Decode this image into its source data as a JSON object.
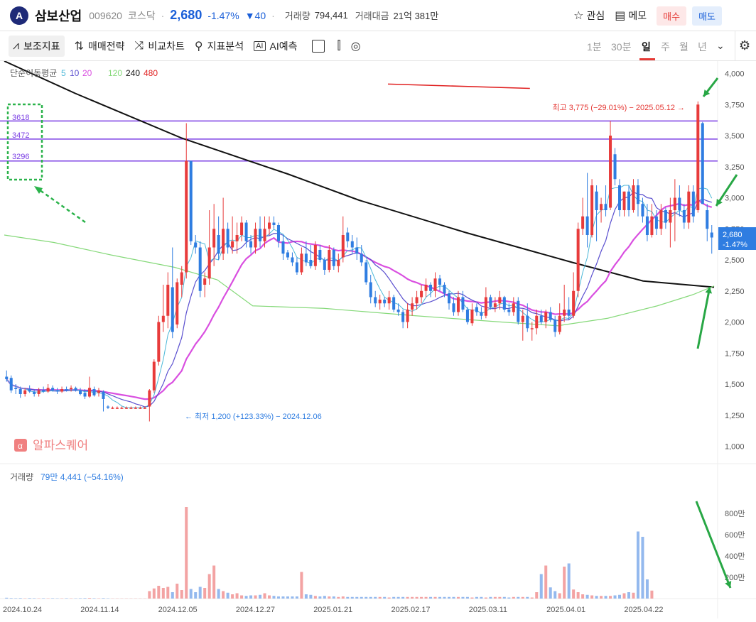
{
  "header": {
    "logo_letter": "A",
    "stock_name": "삼보산업",
    "stock_code": "009620",
    "market": "코스닥",
    "price": "2,680",
    "change_pct": "-1.47%",
    "change_abs": "▼40",
    "volume_label": "거래량",
    "volume": "794,441",
    "amount_label": "거래대금",
    "amount": "21억 381만",
    "watch_label": "관심",
    "memo_label": "메모",
    "buy_label": "매수",
    "sell_label": "매도"
  },
  "toolbar": {
    "items": [
      "보조지표",
      "매매전략",
      "비교차트",
      "지표분석",
      "AI예측"
    ],
    "periods": [
      "1분",
      "30분",
      "일",
      "주",
      "월",
      "년"
    ],
    "selected_period": "일"
  },
  "chart_data": {
    "type": "candlestick",
    "legend_title": "단순이동평균",
    "ma_periods": [
      "5",
      "10",
      "20",
      "120",
      "240",
      "480"
    ],
    "colors": {
      "up": "#e83b3b",
      "down": "#2f7de1",
      "ma5": "#4cb8d8",
      "ma10": "#5a4fcf",
      "ma20": "#d94fe0",
      "ma120": "#86d97a",
      "ma240": "#111111",
      "ma480": "#e02020",
      "level": "#7b3fe4",
      "annot": "#28a745"
    },
    "y_ticks": [
      "4,000",
      "3,750",
      "3,500",
      "3,250",
      "3,000",
      "2,750",
      "2,500",
      "2,250",
      "2,000",
      "1,750",
      "1,500",
      "1,250",
      "1,000"
    ],
    "ylim": [
      900,
      4100
    ],
    "x_ticks": [
      "2024.10.24",
      "2024.11.14",
      "2024.12.05",
      "2024.12.27",
      "2025.01.21",
      "2025.02.17",
      "2025.03.11",
      "2025.04.01",
      "2025.04.22"
    ],
    "levels": [
      {
        "label": "3618",
        "value": 3618
      },
      {
        "label": "3472",
        "value": 3472
      },
      {
        "label": "3296",
        "value": 3296
      }
    ],
    "high_annotation": "최고 3,775 (−29.01%) − 2025.05.12 →",
    "low_annotation": "← 최저 1,200 (+123.33%) − 2024.12.06",
    "last_price": "2,680",
    "last_change": "-1.47%",
    "watermark": "알파스퀘어",
    "volume_title": "거래량",
    "volume_info": "79만 4,441 (−54.16%)",
    "volume_ticks": [
      "800만",
      "600만",
      "400만",
      "200만"
    ],
    "candles": [
      {
        "o": 1560,
        "h": 1610,
        "l": 1520,
        "c": 1540
      },
      {
        "o": 1550,
        "h": 1570,
        "l": 1430,
        "c": 1450
      },
      {
        "o": 1470,
        "h": 1500,
        "l": 1420,
        "c": 1460
      },
      {
        "o": 1460,
        "h": 1480,
        "l": 1390,
        "c": 1420
      },
      {
        "o": 1420,
        "h": 1470,
        "l": 1400,
        "c": 1450
      },
      {
        "o": 1460,
        "h": 1490,
        "l": 1430,
        "c": 1440
      },
      {
        "o": 1440,
        "h": 1460,
        "l": 1400,
        "c": 1420
      },
      {
        "o": 1420,
        "h": 1470,
        "l": 1400,
        "c": 1450
      },
      {
        "o": 1450,
        "h": 1480,
        "l": 1430,
        "c": 1440
      },
      {
        "o": 1440,
        "h": 1500,
        "l": 1430,
        "c": 1470
      },
      {
        "o": 1470,
        "h": 1490,
        "l": 1440,
        "c": 1450
      },
      {
        "o": 1450,
        "h": 1470,
        "l": 1420,
        "c": 1440
      },
      {
        "o": 1440,
        "h": 1480,
        "l": 1430,
        "c": 1460
      },
      {
        "o": 1460,
        "h": 1480,
        "l": 1440,
        "c": 1450
      },
      {
        "o": 1460,
        "h": 1490,
        "l": 1440,
        "c": 1470
      },
      {
        "o": 1470,
        "h": 1480,
        "l": 1440,
        "c": 1450
      },
      {
        "o": 1450,
        "h": 1470,
        "l": 1410,
        "c": 1420
      },
      {
        "o": 1430,
        "h": 1460,
        "l": 1380,
        "c": 1400
      },
      {
        "o": 1400,
        "h": 1560,
        "l": 1390,
        "c": 1470
      },
      {
        "o": 1460,
        "h": 1480,
        "l": 1400,
        "c": 1410
      },
      {
        "o": 1430,
        "h": 1470,
        "l": 1400,
        "c": 1450
      },
      {
        "o": 1440,
        "h": 1450,
        "l": 1280,
        "c": 1380
      },
      {
        "o": 1320,
        "h": 1330,
        "l": 1300,
        "c": 1310
      },
      {
        "o": 1310,
        "h": 1320,
        "l": 1300,
        "c": 1310
      },
      {
        "o": 1310,
        "h": 1320,
        "l": 1300,
        "c": 1310
      },
      {
        "o": 1310,
        "h": 1320,
        "l": 1300,
        "c": 1310
      },
      {
        "o": 1310,
        "h": 1320,
        "l": 1300,
        "c": 1310
      },
      {
        "o": 1310,
        "h": 1320,
        "l": 1300,
        "c": 1310
      },
      {
        "o": 1310,
        "h": 1320,
        "l": 1300,
        "c": 1310
      },
      {
        "o": 1310,
        "h": 1320,
        "l": 1300,
        "c": 1310
      },
      {
        "o": 1310,
        "h": 1320,
        "l": 1300,
        "c": 1310
      },
      {
        "o": 1320,
        "h": 1460,
        "l": 1200,
        "c": 1450
      },
      {
        "o": 1450,
        "h": 1700,
        "l": 1430,
        "c": 1680
      },
      {
        "o": 1680,
        "h": 2050,
        "l": 1650,
        "c": 2000
      },
      {
        "o": 2000,
        "h": 2300,
        "l": 1920,
        "c": 2050
      },
      {
        "o": 2050,
        "h": 2400,
        "l": 1950,
        "c": 2300
      },
      {
        "o": 2280,
        "h": 2600,
        "l": 1870,
        "c": 1920
      },
      {
        "o": 1980,
        "h": 2350,
        "l": 1950,
        "c": 2320
      },
      {
        "o": 2300,
        "h": 2450,
        "l": 2200,
        "c": 2400
      },
      {
        "o": 2400,
        "h": 3600,
        "l": 2350,
        "c": 3296
      },
      {
        "o": 3296,
        "h": 3300,
        "l": 2620,
        "c": 2650
      },
      {
        "o": 2640,
        "h": 2700,
        "l": 2550,
        "c": 2600
      },
      {
        "o": 2600,
        "h": 2650,
        "l": 2200,
        "c": 2250
      },
      {
        "o": 2300,
        "h": 2400,
        "l": 2200,
        "c": 2350
      },
      {
        "o": 2350,
        "h": 2900,
        "l": 2300,
        "c": 2600
      },
      {
        "o": 2600,
        "h": 2950,
        "l": 2450,
        "c": 2750
      },
      {
        "o": 2700,
        "h": 2850,
        "l": 2500,
        "c": 2550
      },
      {
        "o": 2550,
        "h": 3000,
        "l": 2500,
        "c": 2750
      },
      {
        "o": 2750,
        "h": 2800,
        "l": 2550,
        "c": 2600
      },
      {
        "o": 2600,
        "h": 2850,
        "l": 2550,
        "c": 2650
      },
      {
        "o": 2650,
        "h": 2800,
        "l": 2550,
        "c": 2700
      },
      {
        "o": 2700,
        "h": 2850,
        "l": 2650,
        "c": 2800
      },
      {
        "o": 2800,
        "h": 2820,
        "l": 2600,
        "c": 2650
      },
      {
        "o": 2650,
        "h": 2700,
        "l": 2550,
        "c": 2600
      },
      {
        "o": 2600,
        "h": 2800,
        "l": 2550,
        "c": 2750
      },
      {
        "o": 2750,
        "h": 2850,
        "l": 2600,
        "c": 2650
      },
      {
        "o": 2650,
        "h": 2850,
        "l": 2600,
        "c": 2750
      },
      {
        "o": 2750,
        "h": 2850,
        "l": 2700,
        "c": 2800
      },
      {
        "o": 2800,
        "h": 2850,
        "l": 2750,
        "c": 2780
      },
      {
        "o": 2780,
        "h": 2800,
        "l": 2600,
        "c": 2650
      },
      {
        "o": 2650,
        "h": 2700,
        "l": 2500,
        "c": 2550
      },
      {
        "o": 2560,
        "h": 2580,
        "l": 2500,
        "c": 2520
      },
      {
        "o": 2520,
        "h": 2560,
        "l": 2450,
        "c": 2480
      },
      {
        "o": 2480,
        "h": 2520,
        "l": 2380,
        "c": 2400
      },
      {
        "o": 2400,
        "h": 2600,
        "l": 2380,
        "c": 2550
      },
      {
        "o": 2550,
        "h": 2650,
        "l": 2450,
        "c": 2480
      },
      {
        "o": 2500,
        "h": 2620,
        "l": 2430,
        "c": 2450
      },
      {
        "o": 2450,
        "h": 2650,
        "l": 2420,
        "c": 2620
      },
      {
        "o": 2580,
        "h": 2620,
        "l": 2480,
        "c": 2500
      },
      {
        "o": 2500,
        "h": 2520,
        "l": 2380,
        "c": 2420
      },
      {
        "o": 2420,
        "h": 2620,
        "l": 2400,
        "c": 2580
      },
      {
        "o": 2580,
        "h": 2600,
        "l": 2420,
        "c": 2450
      },
      {
        "o": 2450,
        "h": 2550,
        "l": 2400,
        "c": 2500
      },
      {
        "o": 2520,
        "h": 2850,
        "l": 2480,
        "c": 2700
      },
      {
        "o": 2720,
        "h": 2760,
        "l": 2600,
        "c": 2650
      },
      {
        "o": 2650,
        "h": 2700,
        "l": 2550,
        "c": 2600
      },
      {
        "o": 2600,
        "h": 2680,
        "l": 2500,
        "c": 2550
      },
      {
        "o": 2550,
        "h": 2620,
        "l": 2450,
        "c": 2480
      },
      {
        "o": 2480,
        "h": 2500,
        "l": 2300,
        "c": 2320
      },
      {
        "o": 2320,
        "h": 2380,
        "l": 2150,
        "c": 2200
      },
      {
        "o": 2200,
        "h": 2250,
        "l": 2120,
        "c": 2150
      },
      {
        "o": 2150,
        "h": 2220,
        "l": 2100,
        "c": 2180
      },
      {
        "o": 2180,
        "h": 2200,
        "l": 2120,
        "c": 2150
      },
      {
        "o": 2150,
        "h": 2250,
        "l": 2100,
        "c": 2200
      },
      {
        "o": 2200,
        "h": 2220,
        "l": 2080,
        "c": 2100
      },
      {
        "o": 2100,
        "h": 2150,
        "l": 2050,
        "c": 2080
      },
      {
        "o": 2080,
        "h": 2100,
        "l": 1950,
        "c": 2000
      },
      {
        "o": 2000,
        "h": 2150,
        "l": 1950,
        "c": 2100
      },
      {
        "o": 2100,
        "h": 2200,
        "l": 2050,
        "c": 2150
      },
      {
        "o": 2150,
        "h": 2250,
        "l": 2100,
        "c": 2200
      },
      {
        "o": 2200,
        "h": 2300,
        "l": 2150,
        "c": 2250
      },
      {
        "o": 2250,
        "h": 2350,
        "l": 2200,
        "c": 2300
      },
      {
        "o": 2300,
        "h": 2320,
        "l": 2200,
        "c": 2250
      },
      {
        "o": 2250,
        "h": 2400,
        "l": 2200,
        "c": 2350
      },
      {
        "o": 2350,
        "h": 2380,
        "l": 2250,
        "c": 2300
      },
      {
        "o": 2300,
        "h": 2320,
        "l": 2200,
        "c": 2230
      },
      {
        "o": 2230,
        "h": 2250,
        "l": 2100,
        "c": 2150
      },
      {
        "o": 2150,
        "h": 2200,
        "l": 2050,
        "c": 2080
      },
      {
        "o": 2080,
        "h": 2250,
        "l": 2050,
        "c": 2200
      },
      {
        "o": 2200,
        "h": 2250,
        "l": 2080,
        "c": 2100
      },
      {
        "o": 2100,
        "h": 2120,
        "l": 1980,
        "c": 2000
      },
      {
        "o": 1990,
        "h": 2150,
        "l": 1970,
        "c": 2100
      },
      {
        "o": 2120,
        "h": 2150,
        "l": 2050,
        "c": 2080
      },
      {
        "o": 2080,
        "h": 2120,
        "l": 2020,
        "c": 2050
      },
      {
        "o": 2050,
        "h": 2280,
        "l": 2030,
        "c": 2200
      },
      {
        "o": 2200,
        "h": 2220,
        "l": 2100,
        "c": 2120
      },
      {
        "o": 2120,
        "h": 2200,
        "l": 2080,
        "c": 2150
      },
      {
        "o": 2150,
        "h": 2250,
        "l": 2100,
        "c": 2200
      },
      {
        "o": 2200,
        "h": 2210,
        "l": 2080,
        "c": 2100
      },
      {
        "o": 2100,
        "h": 2150,
        "l": 2050,
        "c": 2080
      },
      {
        "o": 2080,
        "h": 2200,
        "l": 2050,
        "c": 2150
      },
      {
        "o": 2170,
        "h": 2200,
        "l": 1980,
        "c": 2000
      },
      {
        "o": 2000,
        "h": 2100,
        "l": 1850,
        "c": 2050
      },
      {
        "o": 2050,
        "h": 2150,
        "l": 1920,
        "c": 1950
      },
      {
        "o": 1950,
        "h": 2000,
        "l": 1850,
        "c": 1950
      },
      {
        "o": 1950,
        "h": 2100,
        "l": 1900,
        "c": 2050
      },
      {
        "o": 2050,
        "h": 2100,
        "l": 1980,
        "c": 2000
      },
      {
        "o": 2000,
        "h": 2100,
        "l": 1950,
        "c": 2080
      },
      {
        "o": 2080,
        "h": 2120,
        "l": 2000,
        "c": 2020
      },
      {
        "o": 2020,
        "h": 2050,
        "l": 1880,
        "c": 1920
      },
      {
        "o": 1920,
        "h": 2150,
        "l": 1900,
        "c": 2050
      },
      {
        "o": 2050,
        "h": 2300,
        "l": 2000,
        "c": 2100
      },
      {
        "o": 2100,
        "h": 2200,
        "l": 2020,
        "c": 2050
      },
      {
        "o": 2050,
        "h": 2400,
        "l": 2030,
        "c": 2250
      },
      {
        "o": 2250,
        "h": 2800,
        "l": 2200,
        "c": 2750
      },
      {
        "o": 2750,
        "h": 3000,
        "l": 2700,
        "c": 2850
      },
      {
        "o": 2850,
        "h": 3200,
        "l": 2600,
        "c": 2700
      },
      {
        "o": 2700,
        "h": 3150,
        "l": 2680,
        "c": 3100
      },
      {
        "o": 3050,
        "h": 3100,
        "l": 2650,
        "c": 2900
      },
      {
        "o": 2900,
        "h": 3000,
        "l": 2800,
        "c": 2950
      },
      {
        "o": 2950,
        "h": 3100,
        "l": 2850,
        "c": 2900
      },
      {
        "o": 2920,
        "h": 3618,
        "l": 2900,
        "c": 3500
      },
      {
        "o": 3350,
        "h": 3400,
        "l": 3100,
        "c": 3150
      },
      {
        "o": 3100,
        "h": 3150,
        "l": 2850,
        "c": 2900
      },
      {
        "o": 2900,
        "h": 3050,
        "l": 2850,
        "c": 3050
      },
      {
        "o": 3050,
        "h": 3100,
        "l": 2850,
        "c": 2900
      },
      {
        "o": 2900,
        "h": 3150,
        "l": 2880,
        "c": 3100
      },
      {
        "o": 3100,
        "h": 3150,
        "l": 2850,
        "c": 2950
      },
      {
        "o": 2950,
        "h": 3000,
        "l": 2800,
        "c": 2850
      },
      {
        "o": 2850,
        "h": 2950,
        "l": 2650,
        "c": 2700
      },
      {
        "o": 2700,
        "h": 2950,
        "l": 2680,
        "c": 2850
      },
      {
        "o": 2850,
        "h": 2900,
        "l": 2700,
        "c": 2750
      },
      {
        "o": 2750,
        "h": 2950,
        "l": 2700,
        "c": 2900
      },
      {
        "o": 2900,
        "h": 2920,
        "l": 2750,
        "c": 2800
      },
      {
        "o": 2800,
        "h": 3000,
        "l": 2600,
        "c": 2900
      },
      {
        "o": 2900,
        "h": 3150,
        "l": 2650,
        "c": 3000
      },
      {
        "o": 3000,
        "h": 3100,
        "l": 2850,
        "c": 2900
      },
      {
        "o": 2900,
        "h": 2950,
        "l": 2750,
        "c": 2800
      },
      {
        "o": 2800,
        "h": 3100,
        "l": 2750,
        "c": 3050
      },
      {
        "o": 3050,
        "h": 3100,
        "l": 2800,
        "c": 2850
      },
      {
        "o": 2900,
        "h": 3775,
        "l": 2880,
        "c": 3750
      },
      {
        "o": 3600,
        "h": 3610,
        "l": 2950,
        "c": 2950
      },
      {
        "o": 2900,
        "h": 2950,
        "l": 2650,
        "c": 2750
      },
      {
        "o": 2720,
        "h": 2780,
        "l": 2550,
        "c": 2680
      }
    ],
    "volumes": [
      8,
      5,
      4,
      5,
      3,
      5,
      4,
      3,
      4,
      3,
      4,
      3,
      3,
      4,
      3,
      3,
      4,
      5,
      6,
      4,
      3,
      5,
      3,
      2,
      2,
      2,
      2,
      2,
      2,
      2,
      2,
      70,
      95,
      120,
      100,
      110,
      60,
      140,
      80,
      860,
      90,
      60,
      110,
      100,
      230,
      310,
      90,
      70,
      55,
      40,
      50,
      30,
      25,
      30,
      30,
      35,
      50,
      30,
      25,
      20,
      20,
      20,
      20,
      20,
      250,
      40,
      35,
      25,
      20,
      25,
      20,
      20,
      15,
      20,
      15,
      15,
      15,
      15,
      15,
      15,
      15,
      15,
      15,
      10,
      15,
      15,
      15,
      15,
      15,
      15,
      15,
      15,
      15,
      15,
      15,
      15,
      15,
      15,
      15,
      15,
      15,
      10,
      15,
      15,
      10,
      15,
      15,
      15,
      15,
      10,
      15,
      15,
      15,
      15,
      10,
      60,
      230,
      310,
      105,
      70,
      50,
      300,
      330,
      85,
      60,
      40,
      35,
      30,
      25,
      25,
      25,
      25,
      30,
      35,
      50,
      60,
      55,
      630,
      580,
      180,
      75
    ],
    "ma_lines": {
      "ma480": [
        [
          0,
          3915
        ],
        [
          0.2,
          3880
        ],
        [
          0.5,
          3790
        ],
        [
          0.75,
          3720
        ],
        [
          0.9,
          3690
        ],
        [
          1,
          3660
        ]
      ],
      "ma240": [
        [
          0,
          4100
        ],
        [
          0.1,
          3840
        ],
        [
          0.25,
          3480
        ],
        [
          0.4,
          3190
        ],
        [
          0.5,
          2980
        ],
        [
          0.65,
          2720
        ],
        [
          0.8,
          2480
        ],
        [
          0.9,
          2330
        ],
        [
          1,
          2280
        ]
      ],
      "ma120": [
        [
          0,
          2700
        ],
        [
          0.07,
          2640
        ],
        [
          0.15,
          2540
        ],
        [
          0.24,
          2440
        ],
        [
          0.3,
          2340
        ],
        [
          0.35,
          2130
        ],
        [
          0.45,
          2110
        ],
        [
          0.58,
          2050
        ],
        [
          0.7,
          2000
        ],
        [
          0.78,
          1970
        ],
        [
          0.85,
          2030
        ],
        [
          0.92,
          2130
        ],
        [
          0.97,
          2220
        ],
        [
          1,
          2290
        ]
      ]
    }
  }
}
